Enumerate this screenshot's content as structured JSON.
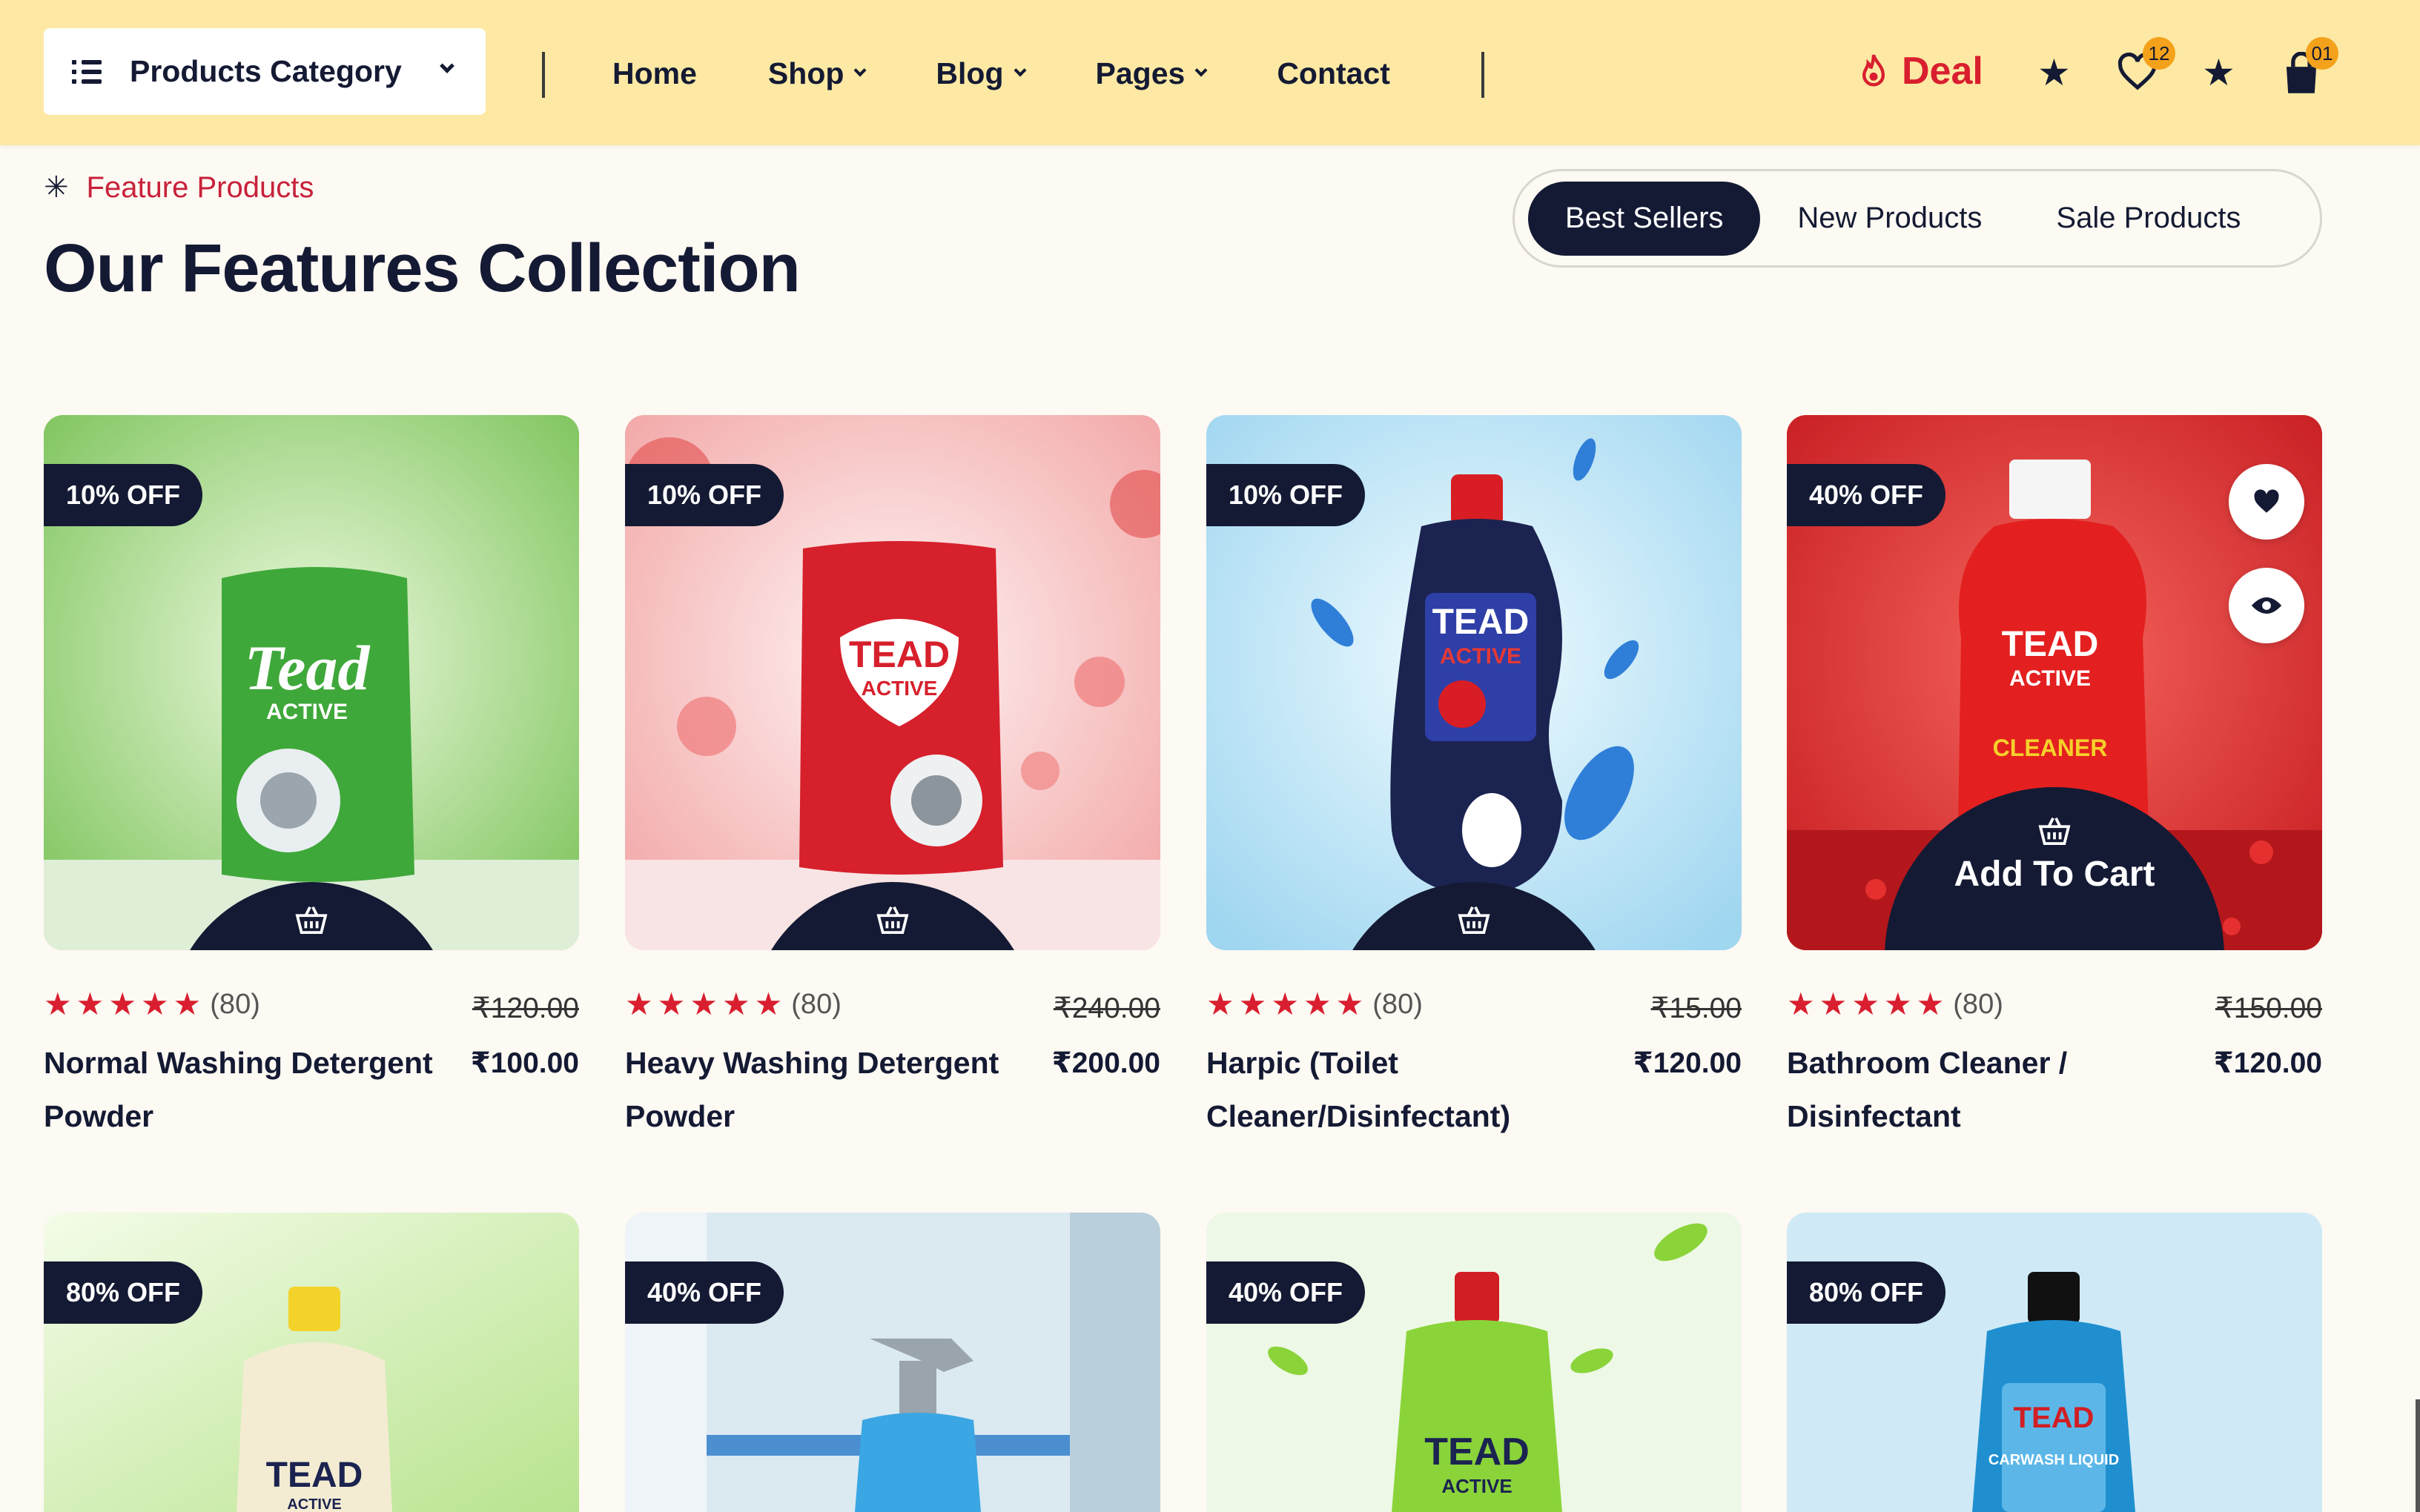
{
  "header": {
    "category_label": "Products Category",
    "nav": [
      {
        "label": "Home",
        "has_dropdown": false
      },
      {
        "label": "Shop",
        "has_dropdown": true
      },
      {
        "label": "Blog",
        "has_dropdown": true
      },
      {
        "label": "Pages",
        "has_dropdown": true
      },
      {
        "label": "Contact",
        "has_dropdown": false
      }
    ],
    "deal_label": "Deal",
    "wishlist_count": "12",
    "cart_count": "01"
  },
  "section": {
    "eyebrow": "Feature Products",
    "title": "Our Features Collection",
    "tabs": [
      {
        "label": "Best Sellers",
        "active": true
      },
      {
        "label": "New Products",
        "active": false
      },
      {
        "label": "Sale Products",
        "active": false
      }
    ]
  },
  "products": [
    {
      "discount": "10% OFF",
      "rating_count": "(80)",
      "stars": 5,
      "old_price": "₹120.00",
      "price": "₹100.00",
      "name": "Normal Washing Detergent Powder",
      "brand_text": "Tead",
      "brand_sub": "ACTIVE",
      "bg_color": "#bfe39a",
      "pack_color": "#3fa83a"
    },
    {
      "discount": "10% OFF",
      "rating_count": "(80)",
      "stars": 5,
      "old_price": "₹240.00",
      "price": "₹200.00",
      "name": "Heavy Washing Detergent Powder",
      "brand_text": "TEAD",
      "brand_sub": "ACTIVE",
      "bg_color": "#f7dada",
      "pack_color": "#d6202c"
    },
    {
      "discount": "10% OFF",
      "rating_count": "(80)",
      "stars": 5,
      "old_price": "₹15.00",
      "price": "₹120.00",
      "name": "Harpic (Toilet Cleaner/Disinfectant)",
      "brand_text": "TEAD",
      "brand_sub": "ACTIVE",
      "bg_color": "#cdeaf8",
      "pack_color": "#1b2350"
    },
    {
      "discount": "40% OFF",
      "rating_count": "(80)",
      "stars": 5,
      "old_price": "₹150.00",
      "price": "₹120.00",
      "name": "Bathroom Cleaner / Disinfectant",
      "brand_text": "TEAD",
      "brand_sub": "ACTIVE",
      "brand_line3": "CLEANER",
      "bg_color": "#e0322f",
      "pack_color": "#e3201f",
      "add_to_cart_label": "Add To Cart"
    }
  ],
  "products_row2": [
    {
      "discount": "80% OFF",
      "brand_text": "TEAD",
      "brand_sub": "ACTIVE",
      "bg_color": "#e2f5c8",
      "pack_color": "#f3ecd2",
      "cap_color": "#f3d22a"
    },
    {
      "discount": "40% OFF",
      "bg_color": "#d9e9f2",
      "pack_color": "#3aa6e3",
      "cap_color": "#9aa4ac"
    },
    {
      "discount": "40% OFF",
      "brand_text": "TEAD",
      "brand_sub": "ACTIVE",
      "bg_color": "#e7f6dc",
      "pack_color": "#8ad43a",
      "cap_color": "#d11e24"
    },
    {
      "discount": "80% OFF",
      "brand_text": "TEAD",
      "brand_sub": "CARWASH LIQUID",
      "bg_color": "#cceaf6",
      "pack_color": "#1f8fd0",
      "cap_color": "#111111"
    }
  ],
  "colors": {
    "navy": "#141a33",
    "header_bg": "#fde9a4",
    "accent_red": "#d91f2f",
    "badge_orange": "#f4a21b",
    "page_bg": "#fdf9f3"
  },
  "icons": [
    "list-icon",
    "chevron-down-icon",
    "flame-icon",
    "star-icon",
    "heart-icon",
    "shopping-bag-icon",
    "sparkle-icon",
    "basket-icon",
    "eye-icon"
  ]
}
